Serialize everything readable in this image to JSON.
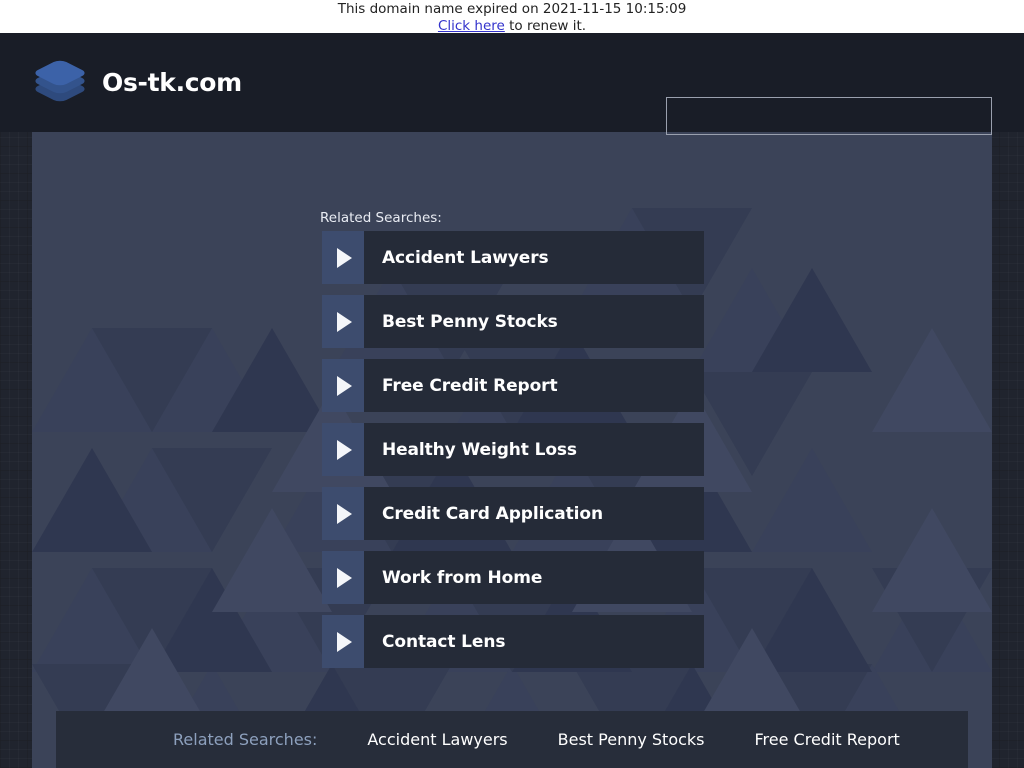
{
  "banner": {
    "expiry_text": "This domain name expired on 2021-11-15 10:15:09",
    "renew_link_label": "Click here",
    "renew_suffix": " to renew it."
  },
  "header": {
    "brand_name": "Os-tk.com",
    "logo_icon": "stacked-layers-icon",
    "search_placeholder": "",
    "search_value": ""
  },
  "main": {
    "related_label": "Related Searches:",
    "results": [
      {
        "label": "Accident Lawyers",
        "icon": "play-triangle-icon"
      },
      {
        "label": "Best Penny Stocks",
        "icon": "play-triangle-icon"
      },
      {
        "label": "Free Credit Report",
        "icon": "play-triangle-icon"
      },
      {
        "label": "Healthy Weight Loss",
        "icon": "play-triangle-icon"
      },
      {
        "label": "Credit Card Application",
        "icon": "play-triangle-icon"
      },
      {
        "label": "Work from Home",
        "icon": "play-triangle-icon"
      },
      {
        "label": "Contact Lens",
        "icon": "play-triangle-icon"
      }
    ]
  },
  "footer": {
    "title": "Related Searches:",
    "links": [
      "Accident Lawyers",
      "Best Penny Stocks",
      "Free Credit Report"
    ]
  },
  "colors": {
    "banner_bg": "#ffffff",
    "banner_text": "#222222",
    "banner_link": "#3333cc",
    "header_bg": "#191d27",
    "page_bg": "#20242e",
    "panel_bg": "#3b4358",
    "row_arrow_bg": "#3d4c6e",
    "row_body_bg": "#252b38",
    "row_text": "#ffffff",
    "footer_bg": "#272d3a",
    "footer_title": "#8da0bd",
    "logo_blue": "#3c62a8"
  }
}
